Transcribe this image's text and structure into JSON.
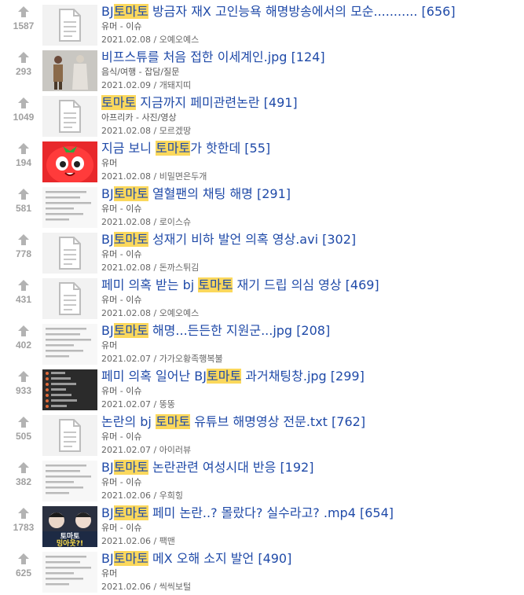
{
  "posts": [
    {
      "votes": "1587",
      "pre": "BJ",
      "hl": "토마토",
      "post": " 방금자 재X 고인능욕 해명방송에서의 모순...........",
      "comments": "[656]",
      "category": "유머 - 이슈",
      "date": "2021.02.08",
      "author": "오예오예스",
      "thumb": "doc"
    },
    {
      "votes": "293",
      "pre": "비프스튜를 처음 접한 이세계인.jpg",
      "hl": "",
      "post": "",
      "comments": "[124]",
      "category": "음식/여행 - 잡담/질문",
      "date": "2021.02.09",
      "author": "개돼지띠",
      "thumb": "figures"
    },
    {
      "votes": "1049",
      "pre": "",
      "hl": "토마토",
      "post": " 지금까지 페미관련논란",
      "comments": "[491]",
      "category": "아프리카 - 사진/영상",
      "date": "2021.02.08",
      "author": "모르겠땅",
      "thumb": "doc"
    },
    {
      "votes": "194",
      "pre": "지금 보니 ",
      "hl": "토마토",
      "post": "가 핫한데",
      "comments": "[55]",
      "category": "유머",
      "date": "2021.02.08",
      "author": "비밀면은두개",
      "thumb": "tomato"
    },
    {
      "votes": "581",
      "pre": "BJ",
      "hl": "토마토",
      "post": " 열혈팬의 채팅 해명",
      "comments": "[291]",
      "category": "유머 - 이슈",
      "date": "2021.02.08",
      "author": "로이스슈",
      "thumb": "textlight"
    },
    {
      "votes": "778",
      "pre": "BJ",
      "hl": "토마토",
      "post": " 성재기 비하 발언 의혹 영상.avi",
      "comments": "[302]",
      "category": "유머 - 이슈",
      "date": "2021.02.08",
      "author": "돈까스튀김",
      "thumb": "doc"
    },
    {
      "votes": "431",
      "pre": "페미 의혹 받는 bj ",
      "hl": "토마토",
      "post": " 재기 드립 의심 영상",
      "comments": "[469]",
      "category": "유머 - 이슈",
      "date": "2021.02.08",
      "author": "오예오예스",
      "thumb": "doc"
    },
    {
      "votes": "402",
      "pre": "BJ",
      "hl": "토마토",
      "post": " 해명...든든한 지원군...jpg",
      "comments": "[208]",
      "category": "유머",
      "date": "2021.02.07",
      "author": "가가오황족행복불",
      "thumb": "textlight"
    },
    {
      "votes": "933",
      "pre": "페미 의혹 일어난 BJ",
      "hl": "토마토",
      "post": " 과거채팅창.jpg",
      "comments": "[299]",
      "category": "유머 - 이슈",
      "date": "2021.02.07",
      "author": "뚱뚱",
      "thumb": "chatdark"
    },
    {
      "votes": "505",
      "pre": "논란의 bj ",
      "hl": "토마토",
      "post": " 유튜브 해명영상 전문.txt",
      "comments": "[762]",
      "category": "유머 - 이슈",
      "date": "2021.02.07",
      "author": "아이러뷰",
      "thumb": "doc"
    },
    {
      "votes": "382",
      "pre": "BJ",
      "hl": "토마토",
      "post": " 논란관련 여성시대 반응",
      "comments": "[192]",
      "category": "유머 - 이슈",
      "date": "2021.02.06",
      "author": "우희힝",
      "thumb": "textlight"
    },
    {
      "votes": "1783",
      "pre": "BJ",
      "hl": "토마토",
      "post": " 페미 논란..? 몰랐다? 실수라고? .mp4",
      "comments": "[654]",
      "category": "유머 - 이슈",
      "date": "2021.02.06",
      "author": "팩맨",
      "thumb": "video"
    },
    {
      "votes": "625",
      "pre": "BJ",
      "hl": "토마토",
      "post": " 메X 오해 소지 발언",
      "comments": "[490]",
      "category": "유머",
      "date": "2021.02.06",
      "author": "씩씩보털",
      "thumb": "textlight"
    }
  ],
  "video_thumb_text": [
    "토마토",
    "밍아웃?!"
  ]
}
